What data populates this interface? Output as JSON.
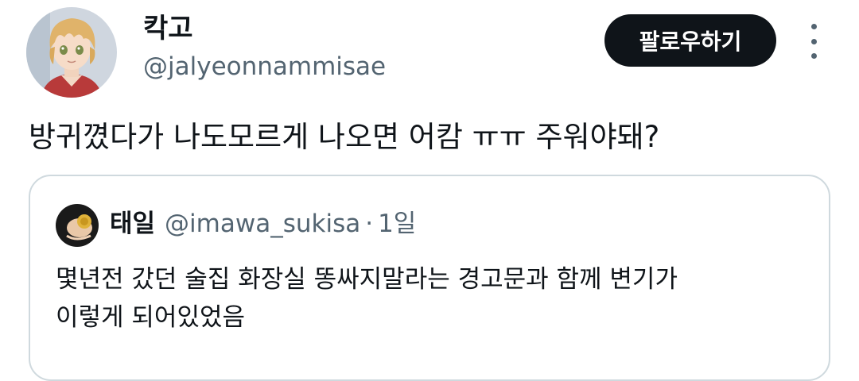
{
  "author": {
    "display_name": "칵고",
    "handle": "@jalyeonnammisae"
  },
  "follow_button_label": "팔로우하기",
  "tweet": {
    "text": "방귀꼈다가 나도모르게 나오면 어캄 ㅠㅠ 주워야돼?"
  },
  "quote": {
    "display_name": "태일",
    "handle": "@imawa_sukisa",
    "separator": "·",
    "time": "1일",
    "text_line1": "몇년전 갔던 술집 화장실 똥싸지말라는 경고문과 함께 변기가",
    "text_line2": "이렇게 되어있었음"
  },
  "icons": {
    "more": "more-vertical-icon"
  },
  "colors": {
    "primary_text": "#0f1419",
    "secondary_text": "#536471",
    "button_bg": "#0f1419",
    "border": "#cfd9de"
  }
}
